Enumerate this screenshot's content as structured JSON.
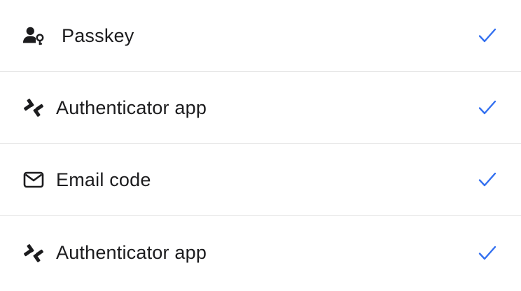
{
  "methods": [
    {
      "label": "Passkey",
      "icon": "passkey-icon",
      "checked": true
    },
    {
      "label": "Authenticator app",
      "icon": "authenticator-icon",
      "checked": true
    },
    {
      "label": "Email code",
      "icon": "envelope-icon",
      "checked": true
    },
    {
      "label": "Authenticator app",
      "icon": "authenticator-icon",
      "checked": true
    }
  ],
  "colors": {
    "text": "#1c1c1e",
    "check": "#3370f0",
    "divider": "#e2e2e2"
  }
}
